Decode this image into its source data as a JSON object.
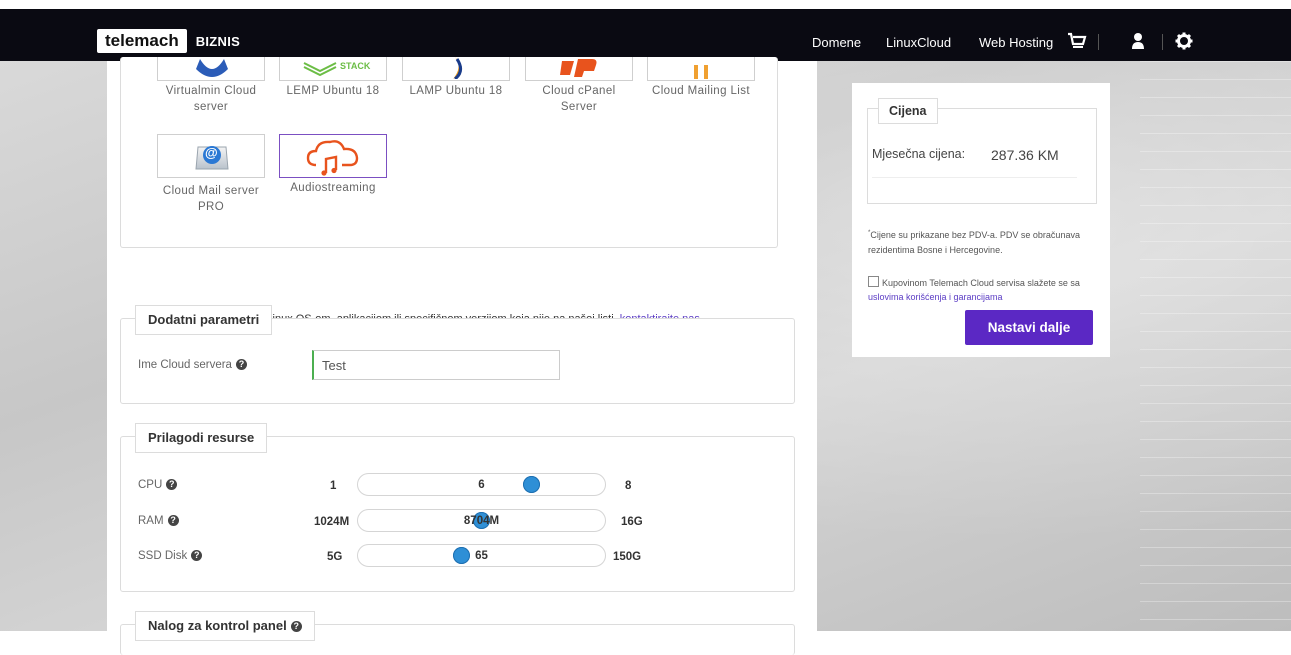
{
  "nav": {
    "brand": "telemach",
    "brand_sub": "BIZNIS",
    "links": [
      "Domene",
      "LinuxCloud",
      "Web Hosting"
    ],
    "icons": [
      "cart-icon",
      "user-icon",
      "gear-icon"
    ]
  },
  "apps": {
    "row1": [
      {
        "label_line1": "Virtualmin Cloud",
        "label_line2": "server"
      },
      {
        "label_line1": "LEMP Ubuntu 18",
        "label_line2": ""
      },
      {
        "label_line1": "LAMP Ubuntu 18",
        "label_line2": ""
      },
      {
        "label_line1": "Cloud cPanel",
        "label_line2": "Server"
      },
      {
        "label_line1": "Cloud Mailing List",
        "label_line2": ""
      }
    ],
    "row2": [
      {
        "label_line1": "Cloud Mail server",
        "label_line2": "PRO",
        "selected": false
      },
      {
        "label_line1": "Audiostreaming",
        "label_line2": "",
        "selected": true
      }
    ],
    "lemp_logo_text": "STACK",
    "mail_logo_text": "@",
    "note": "*Ukoliko imate potrebu za Linux OS-om, aplikacijom ili specifičnom verzijom koja nije na našoj listi, ",
    "note_link": "kontaktirajte nas",
    "note_end": "."
  },
  "params": {
    "legend": "Dodatni parametri",
    "name_label": "Ime Cloud servera",
    "name_value": "Test"
  },
  "resources": {
    "legend": "Prilagodi resurse",
    "items": [
      {
        "label": "CPU",
        "min": "1",
        "max": "8",
        "value": "6",
        "fraction": 0.714
      },
      {
        "label": "RAM",
        "min": "1024M",
        "max": "16G",
        "value": "8704M",
        "fraction": 0.5
      },
      {
        "label": "SSD Disk",
        "min": "5G",
        "max": "150G",
        "value": "65",
        "fraction": 0.414
      }
    ]
  },
  "panel": {
    "legend": "Nalog za kontrol panel"
  },
  "price": {
    "legend": "Cijena",
    "label": "Mjesečna cijena:",
    "value": "287.36 KM",
    "disclaimer_mark": "*",
    "disclaimer": "Cijene su prikazane bez PDV-a. PDV se obračunava rezidentima Bosne i Hercegovine.",
    "agree_text": "Kupovinom Telemach Cloud servisa slažete se sa ",
    "agree_link": "uslovima korišćenja i garancijama",
    "button": "Nastavi dalje"
  },
  "colors": {
    "accent": "#5b28c4",
    "nav_bg": "#0a0a12",
    "slider_thumb": "#2e8fd6",
    "input_focus": "#4caf50"
  }
}
